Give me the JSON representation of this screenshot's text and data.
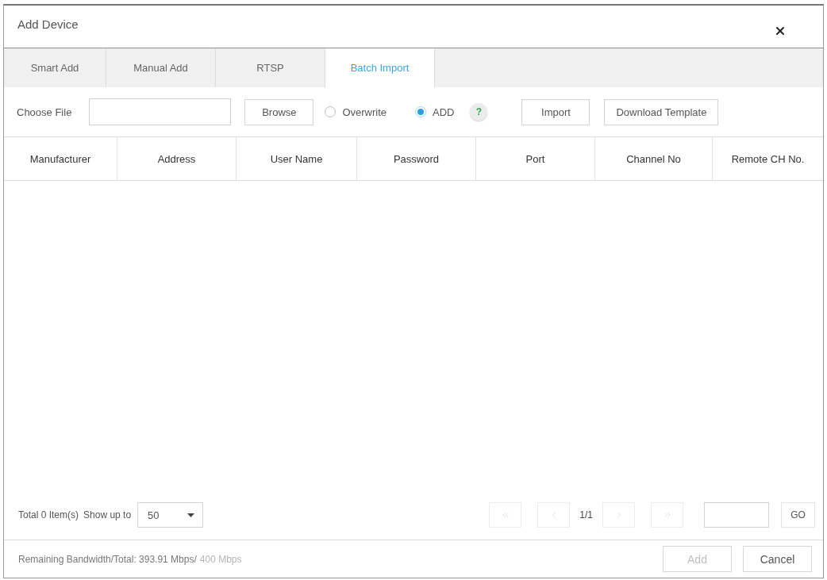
{
  "dialog": {
    "title": "Add Device"
  },
  "tabs": [
    {
      "label": "Smart Add",
      "selected": false
    },
    {
      "label": "Manual Add",
      "selected": false
    },
    {
      "label": "RTSP",
      "selected": false
    },
    {
      "label": "Batch Import",
      "selected": true
    }
  ],
  "toolbar": {
    "file_label": "Choose File",
    "browse_button": "Browse",
    "mode_options": [
      {
        "label": "Overwrite",
        "selected": false
      },
      {
        "label": "ADD",
        "selected": true
      }
    ],
    "help_button": "?",
    "import_button": "Import",
    "template_button": "Download Template"
  },
  "table": {
    "columns": [
      "Manufacturer",
      "Address",
      "User Name",
      "Password",
      "Port",
      "Channel No",
      "Remote CH No."
    ]
  },
  "pagination": {
    "total": "Total 0 Item(s)",
    "show_up_to_label": "Show up to",
    "page_size": "50",
    "nav_buttons": [
      {
        "kind": "first",
        "disabled": true
      },
      {
        "kind": "prev",
        "disabled": true
      },
      {
        "kind": "next",
        "disabled": true
      },
      {
        "kind": "last",
        "disabled": true
      }
    ],
    "page": "1/1",
    "go_button": "GO"
  },
  "footer": {
    "bandwidth_text": "Remaining Bandwidth/Total: 393.91 Mbps/",
    "bandwidth_total": "400 Mbps",
    "buttons": [
      {
        "label": "Add",
        "disabled": true
      },
      {
        "label": "Cancel",
        "disabled": false
      }
    ]
  }
}
